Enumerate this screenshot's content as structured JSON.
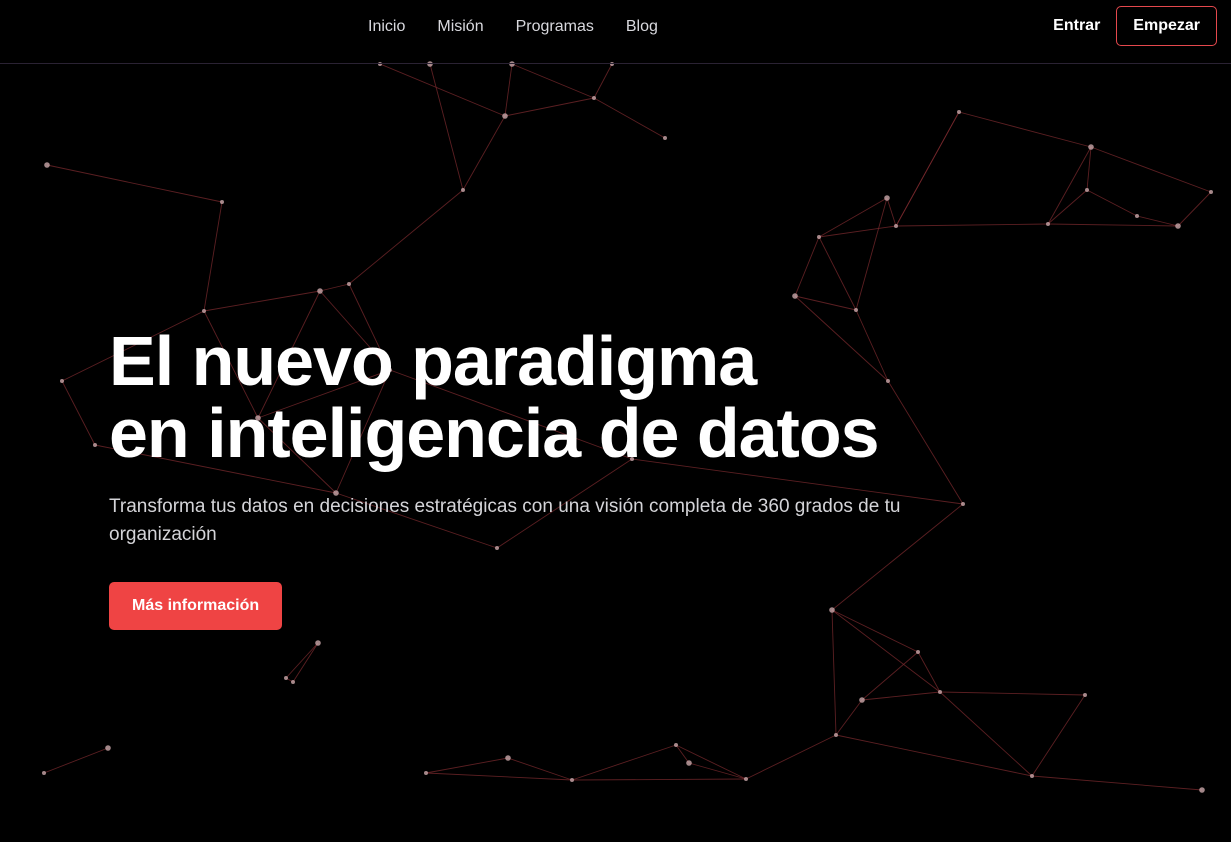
{
  "nav": {
    "links": [
      "Inicio",
      "Misión",
      "Programas",
      "Blog"
    ],
    "login_label": "Entrar",
    "start_label": "Empezar"
  },
  "hero": {
    "title_line1": "El nuevo paradigma",
    "title_line2": "en inteligencia de datos",
    "subtitle": "Transforma tus datos en decisiones estratégicas con una visión completa de 360 grados de tu organización",
    "cta_label": "Más información"
  },
  "colors": {
    "background": "#000000",
    "accent": "#ef4444",
    "network_line": "#7a2a2e",
    "network_node": "#c9a7aa"
  }
}
